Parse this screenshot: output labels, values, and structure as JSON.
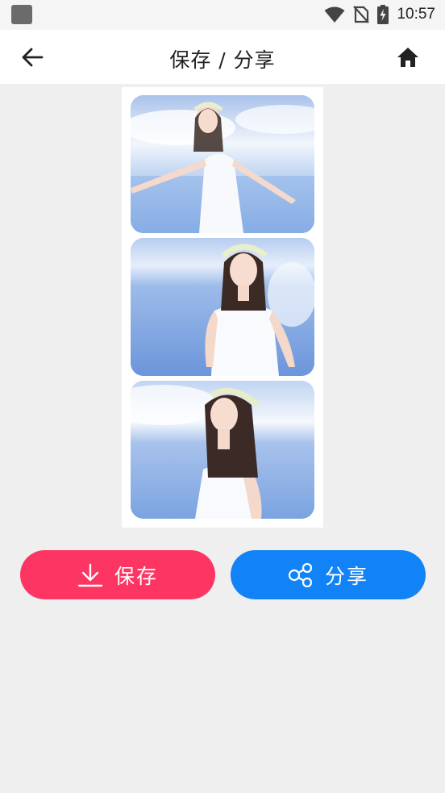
{
  "status_bar": {
    "time": "10:57",
    "icons": [
      "app-notification-icon",
      "wifi-icon",
      "no-sim-icon",
      "battery-charging-icon"
    ]
  },
  "app_bar": {
    "title": "保存 / 分享",
    "back_icon": "arrow-left-icon",
    "home_icon": "home-icon"
  },
  "collage": {
    "photos": [
      {
        "description_icon": "photo-girl-arms-spread"
      },
      {
        "description_icon": "photo-girl-hands-behind"
      },
      {
        "description_icon": "photo-girl-turning"
      }
    ]
  },
  "actions": {
    "save_label": "保存",
    "save_icon": "download-icon",
    "save_color": "#fc3563",
    "share_label": "分享",
    "share_icon": "share-icon",
    "share_color": "#1283f7"
  },
  "colors": {
    "background": "#efefef",
    "app_bar": "#ffffff"
  }
}
